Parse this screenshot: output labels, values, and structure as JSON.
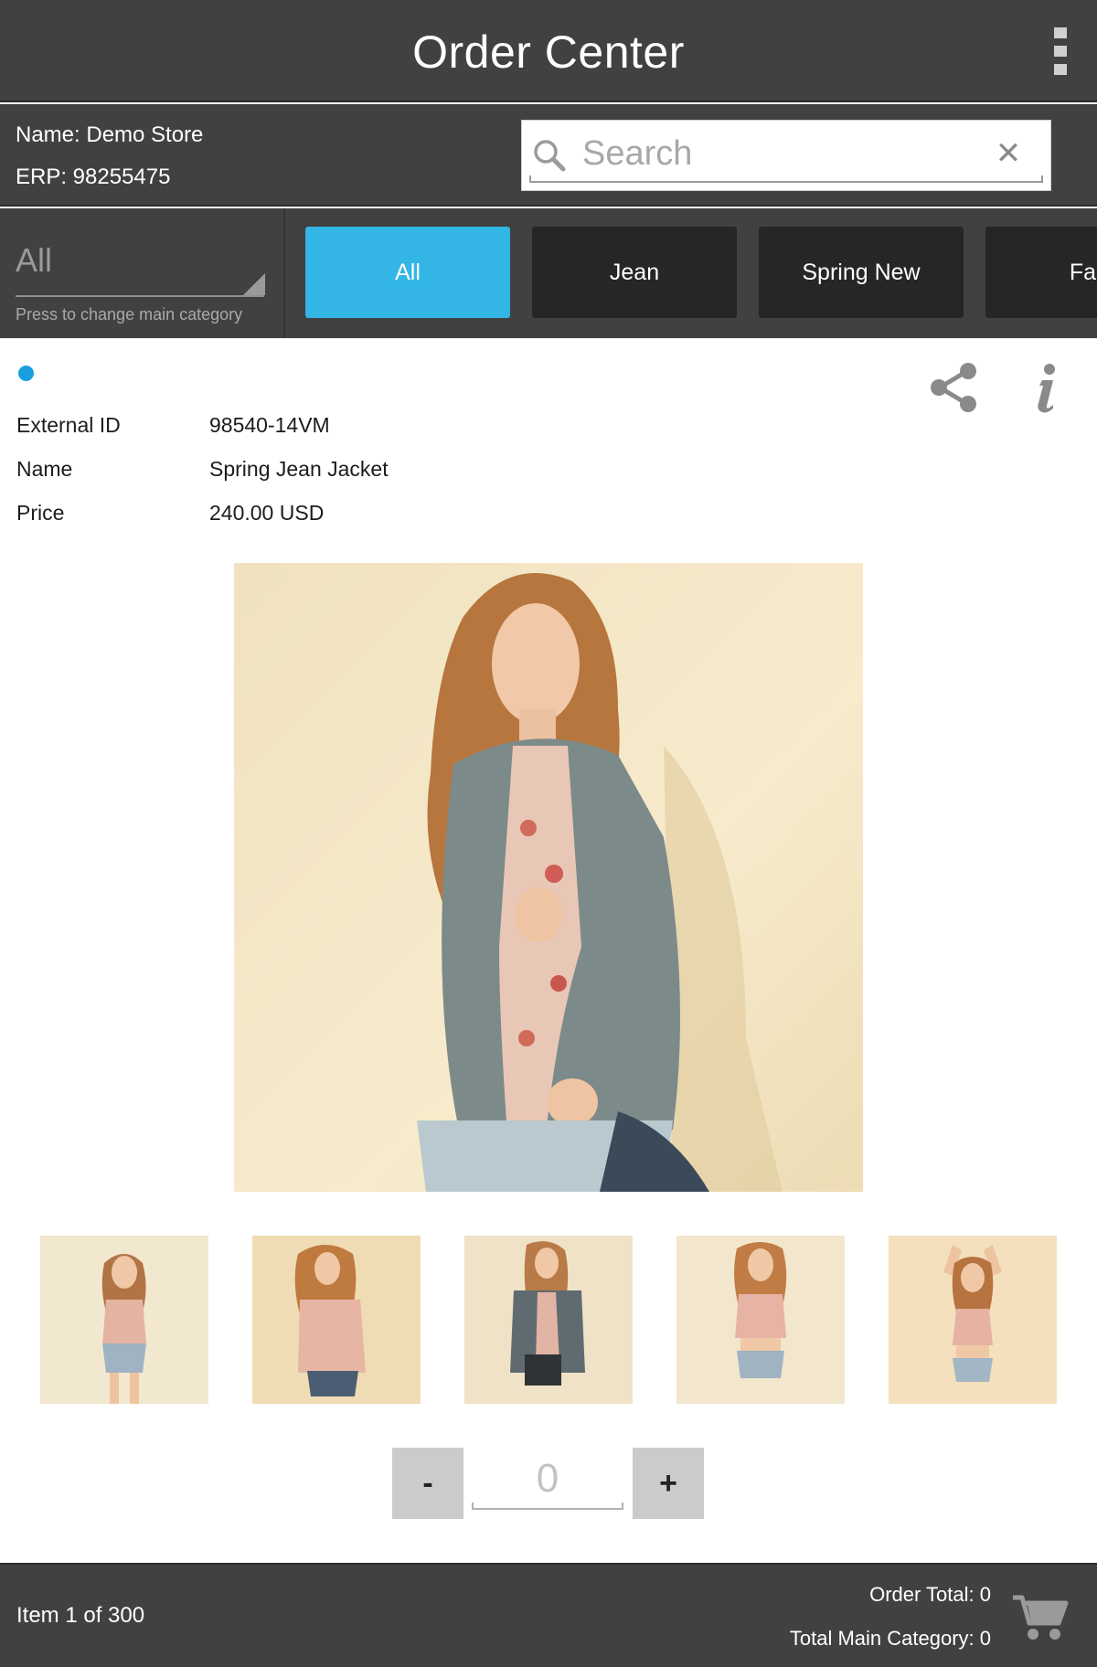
{
  "app": {
    "title": "Order Center",
    "menu_icon": "overflow-menu-icon"
  },
  "store": {
    "name": "Name: Demo Store",
    "erp": "ERP: 98255475"
  },
  "search": {
    "placeholder": "Search",
    "value": "",
    "clear_glyph": "✕"
  },
  "main_category": {
    "value": "All",
    "hint": "Press to change main category"
  },
  "category_tabs": [
    {
      "label": "All",
      "active": true
    },
    {
      "label": "Jean",
      "active": false
    },
    {
      "label": "Spring New",
      "active": false
    },
    {
      "label": "Fall",
      "active": false
    }
  ],
  "product": {
    "attributes": [
      {
        "label": "External ID",
        "value": "98540-14VM"
      },
      {
        "label": "Name",
        "value": "Spring Jean Jacket"
      },
      {
        "label": "Price",
        "value": "240.00 USD"
      }
    ],
    "thumbnail_count": 5
  },
  "quantity": {
    "decrement_label": "-",
    "value": "0",
    "increment_label": "+"
  },
  "footer": {
    "item_count": "Item 1 of 300",
    "order_total": "Order Total: 0",
    "main_category_total": "Total Main Category: 0"
  },
  "colors": {
    "bar_background": "#414141",
    "active_tab": "#33b5e5",
    "inactive_tab": "#262626",
    "indicator_dot": "#1a9ee0"
  }
}
